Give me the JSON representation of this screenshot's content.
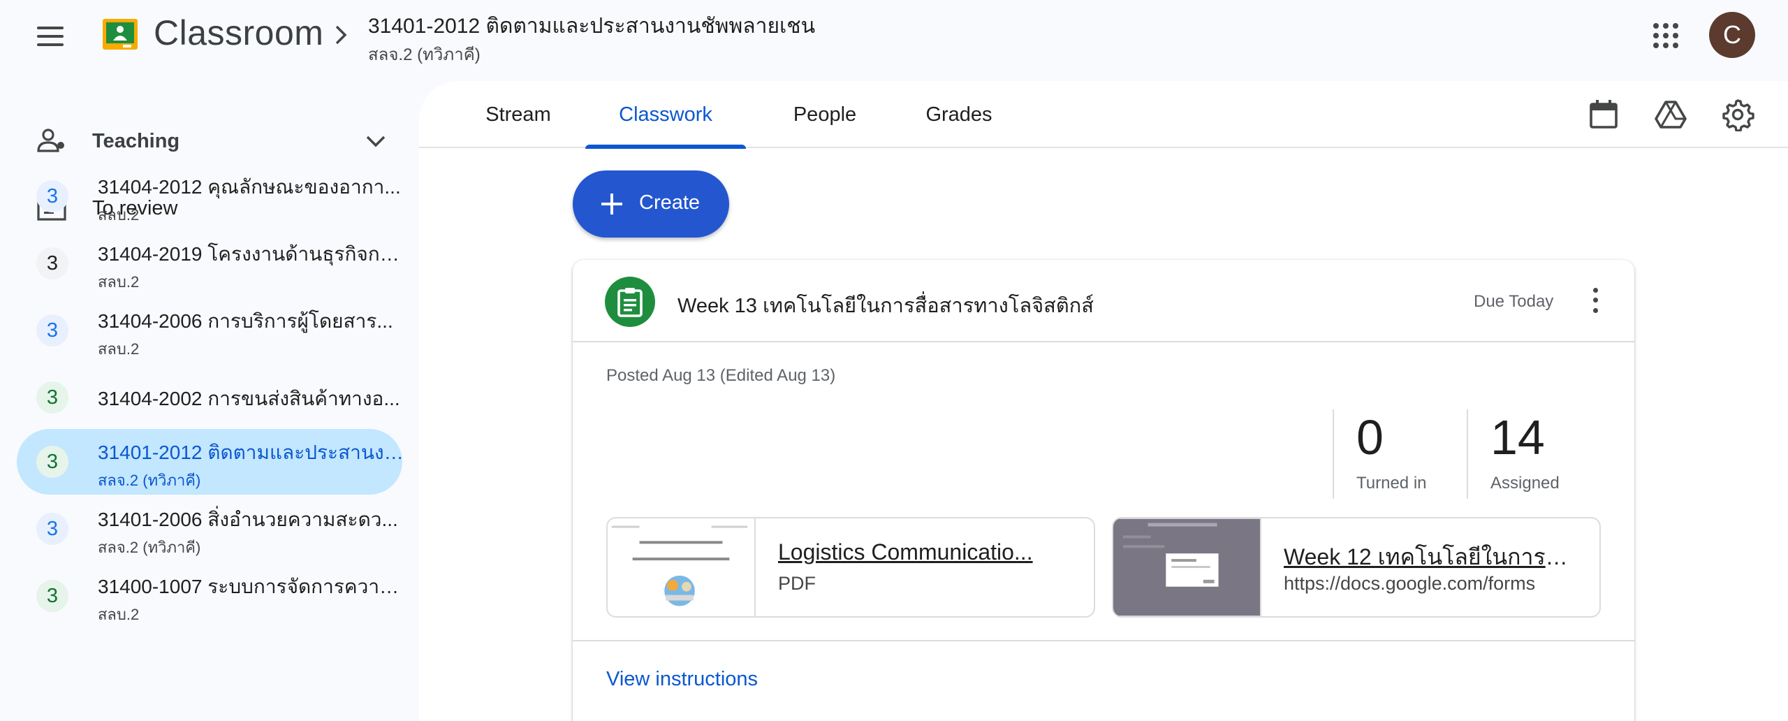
{
  "header": {
    "app_name": "Classroom",
    "class_title": "31401-2012 ติดตามและประสานงานชัพพลายเชน",
    "class_section": "สลจ.2 (ทวิภาคี)",
    "avatar_letter": "C",
    "avatar_color": "#5c3a2e"
  },
  "sidebar": {
    "teaching_label": "Teaching",
    "to_review_label": "To review",
    "courses": [
      {
        "badge": "3",
        "name": "31404-2012 คุณลักษณะของอากา...",
        "section": "สลบ.2",
        "badge_bg": "#e8f0fe",
        "badge_color": "#1a73e8"
      },
      {
        "badge": "3",
        "name": "31404-2019 โครงงานด้านธุรกิจกา...",
        "section": "สลบ.2",
        "badge_bg": "#f1f3f4",
        "badge_color": "#202124"
      },
      {
        "badge": "3",
        "name": "31404-2006 การบริการผู้โดยสาร...",
        "section": "สลบ.2",
        "badge_bg": "#e8f0fe",
        "badge_color": "#1a73e8"
      },
      {
        "badge": "3",
        "name": "31404-2002 การขนส่งสินค้าทางอ...",
        "section": "",
        "badge_bg": "#e6f4ea",
        "badge_color": "#137333"
      },
      {
        "badge": "3",
        "name": "31401-2012 ติดตามและประสานงา...",
        "section": "สลจ.2 (ทวิภาคี)",
        "badge_bg": "#e6f4ea",
        "badge_color": "#137333"
      },
      {
        "badge": "3",
        "name": "31401-2006 สิ่งอำนวยความสะดว...",
        "section": "สลจ.2 (ทวิภาคี)",
        "badge_bg": "#e8f0fe",
        "badge_color": "#1a73e8"
      },
      {
        "badge": "3",
        "name": "31400-1007 ระบบการจัดการความ...",
        "section": "สลบ.2",
        "badge_bg": "#e6f4ea",
        "badge_color": "#137333"
      }
    ]
  },
  "tabs": [
    "Stream",
    "Classwork",
    "People",
    "Grades"
  ],
  "create_label": "Create",
  "assignment": {
    "title": "Week 13 เทคโนโลยีในการสื่อสารทางโลจิสติกส์",
    "due": "Due Today",
    "posted": "Posted Aug 13 (Edited Aug 13)",
    "turned_in_count": "0",
    "turned_in_label": "Turned in",
    "assigned_count": "14",
    "assigned_label": "Assigned",
    "attachments": [
      {
        "name": "Logistics Communicatio...",
        "type": "PDF"
      },
      {
        "name": "Week 12 เทคโนโลยีในการสื่...",
        "type": "https://docs.google.com/forms"
      }
    ],
    "view_instructions": "View instructions"
  },
  "colors": {
    "accent": "#0b57d0",
    "create_button": "#2456d0",
    "assignment_icon": "#1e8e3e",
    "selected_course": "#c2e7ff"
  }
}
